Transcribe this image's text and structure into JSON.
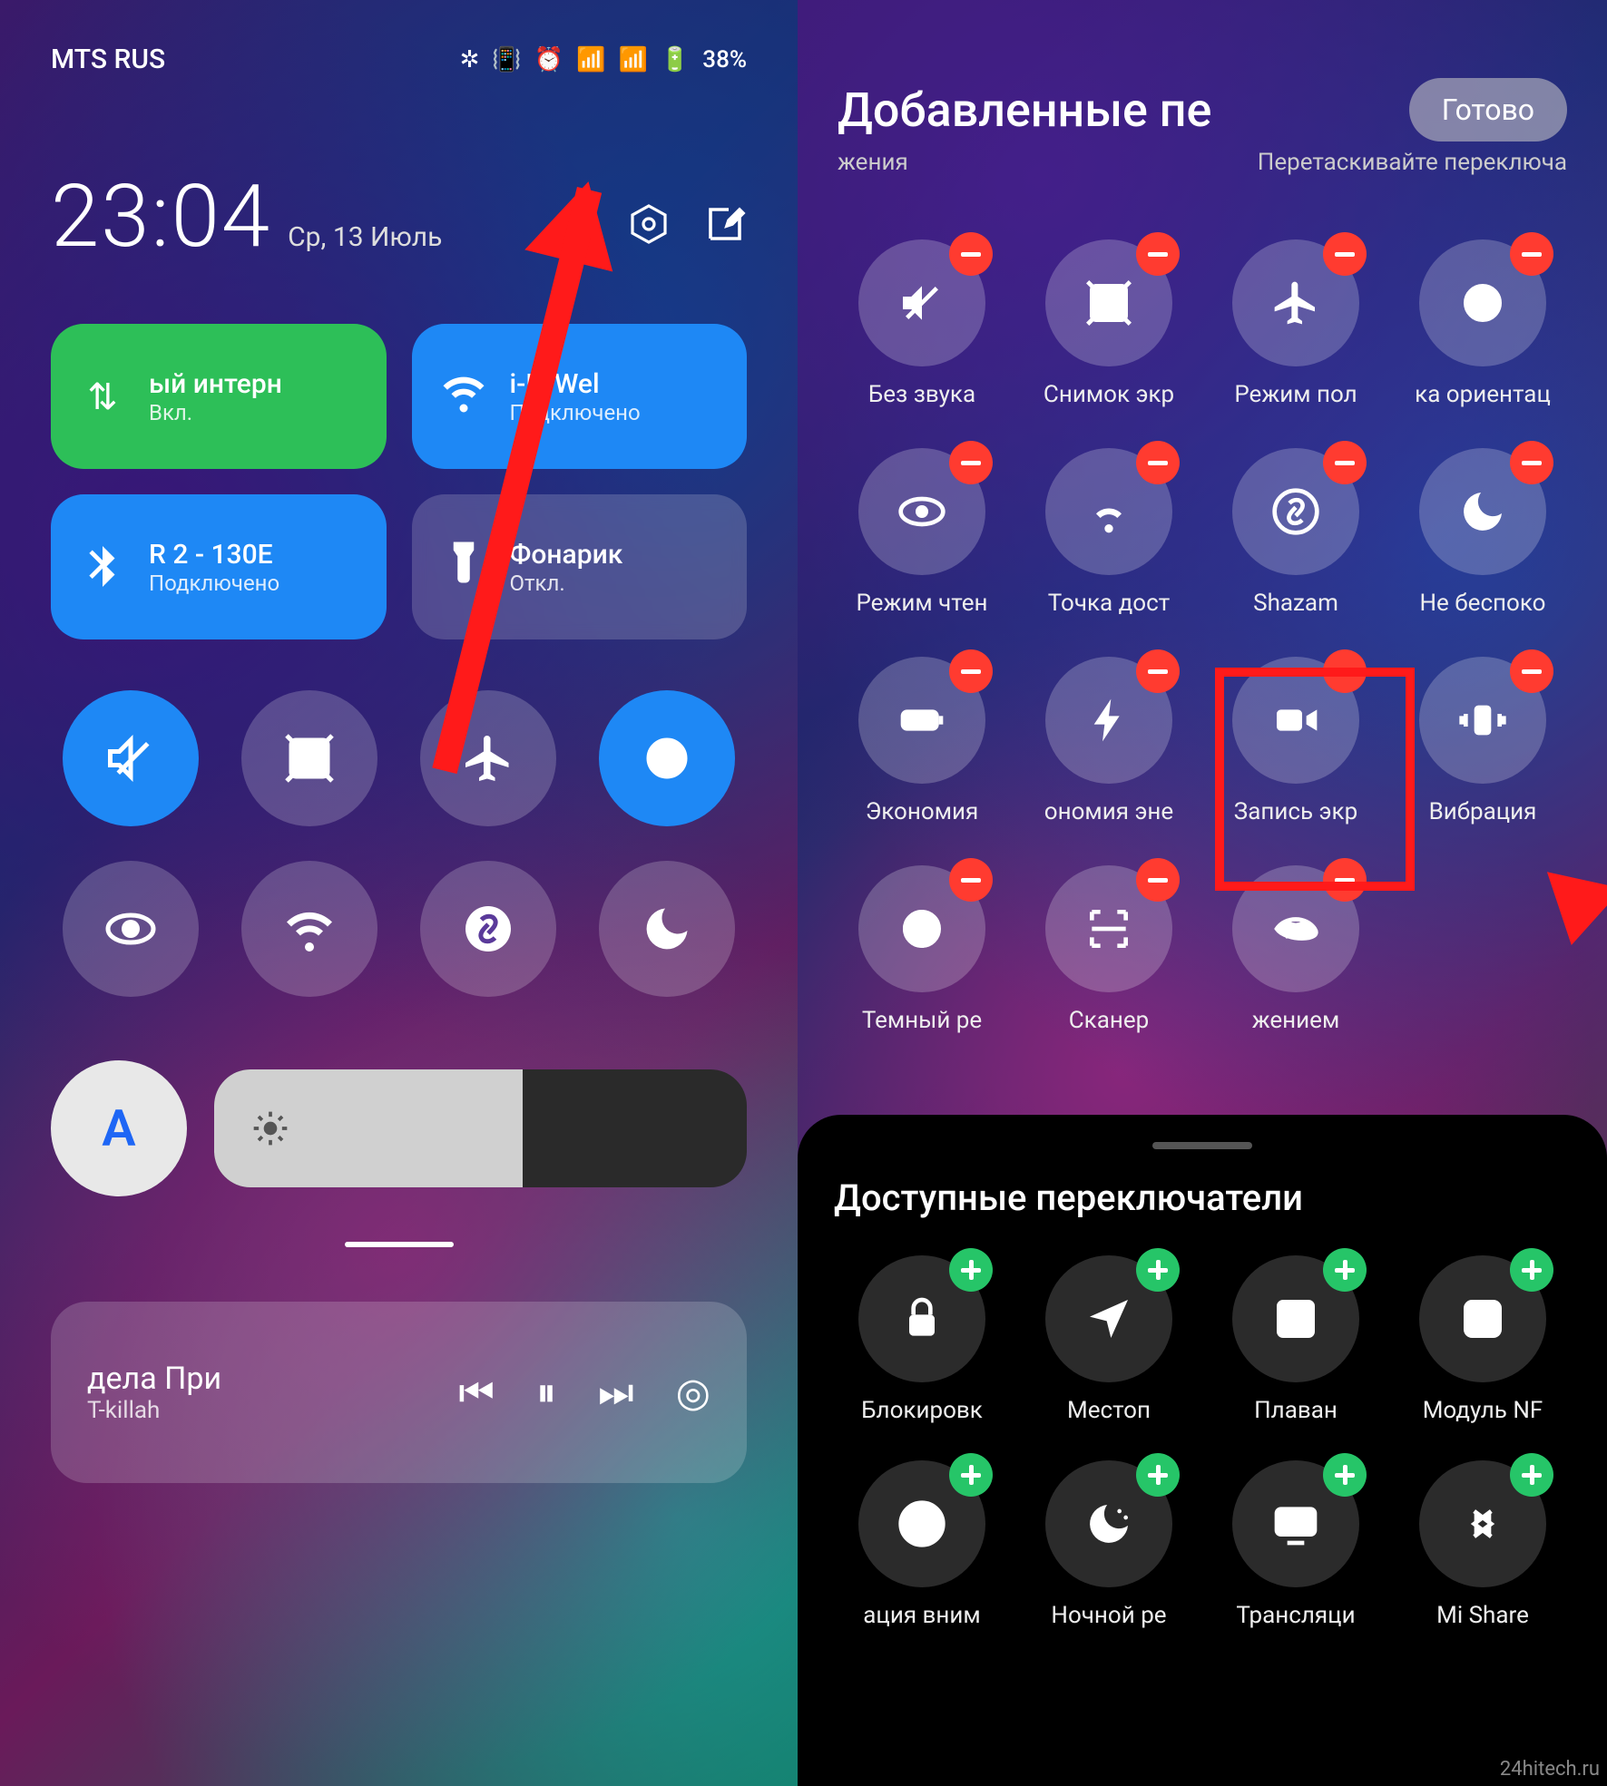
{
  "left": {
    "carrier": "MTS RUS",
    "battery": "38%",
    "time": "23:04",
    "date": "Ср, 13 Июль",
    "tiles": [
      {
        "title": "ый интерн",
        "sub": "Вкл."
      },
      {
        "title": "i-Fi      Wel",
        "sub": "Подключено"
      },
      {
        "title": "R 2 - 130E",
        "sub": "Подключено"
      },
      {
        "title": "Фонарик",
        "sub": "Откл."
      }
    ],
    "auto_label": "A",
    "media": {
      "title": "дела     При",
      "artist": "T-killah"
    }
  },
  "right": {
    "title": "Добавленные пе",
    "done": "Готово",
    "sub_left": "жения",
    "sub_right": "Перетаскивайте переключа",
    "items": [
      {
        "label": "Без звука"
      },
      {
        "label": "Снимок экр"
      },
      {
        "label": "Режим пол"
      },
      {
        "label": "ка ориентац"
      },
      {
        "label": "Режим чтен"
      },
      {
        "label": "Точка дост"
      },
      {
        "label": "Shazam"
      },
      {
        "label": "Не беспоко"
      },
      {
        "label": "Экономия"
      },
      {
        "label": "ономия эне"
      },
      {
        "label": "Запись экр"
      },
      {
        "label": "Вибрация"
      },
      {
        "label": "Темный ре"
      },
      {
        "label": "Сканер"
      },
      {
        "label": "жением"
      }
    ],
    "avail_title": "Доступные переключатели",
    "avail": [
      {
        "label": "Блокировк"
      },
      {
        "label": "Местоп"
      },
      {
        "label": "Плаван"
      },
      {
        "label": "Модуль NF"
      },
      {
        "label": "ация вним"
      },
      {
        "label": "Ночной ре"
      },
      {
        "label": "Трансляци"
      },
      {
        "label": "Mi Share"
      }
    ]
  },
  "watermark": "24hitech.ru"
}
